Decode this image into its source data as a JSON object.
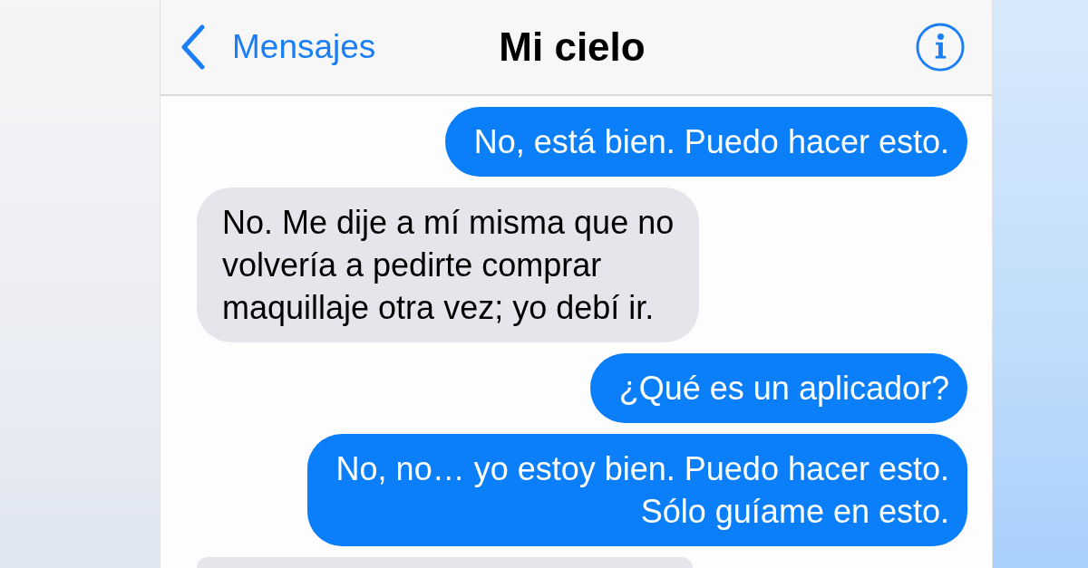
{
  "nav_bar": {
    "back_label": "Mensajes",
    "title": "Mi cielo"
  },
  "messages": [
    {
      "kind": "outgoing",
      "text": "No, está bien. Puedo hacer esto."
    },
    {
      "kind": "incoming",
      "text": "No. Me dije a mí misma que no\nvolvería a pedirte comprar\nmaquillaje otra vez; yo debí ir."
    },
    {
      "kind": "outgoing",
      "text": "¿Qué es un aplicador?"
    },
    {
      "kind": "outgoing",
      "text": "No, no… yo estoy bien. Puedo hacer esto.\nSólo guíame en esto."
    },
    {
      "kind": "incoming"
    }
  ]
}
